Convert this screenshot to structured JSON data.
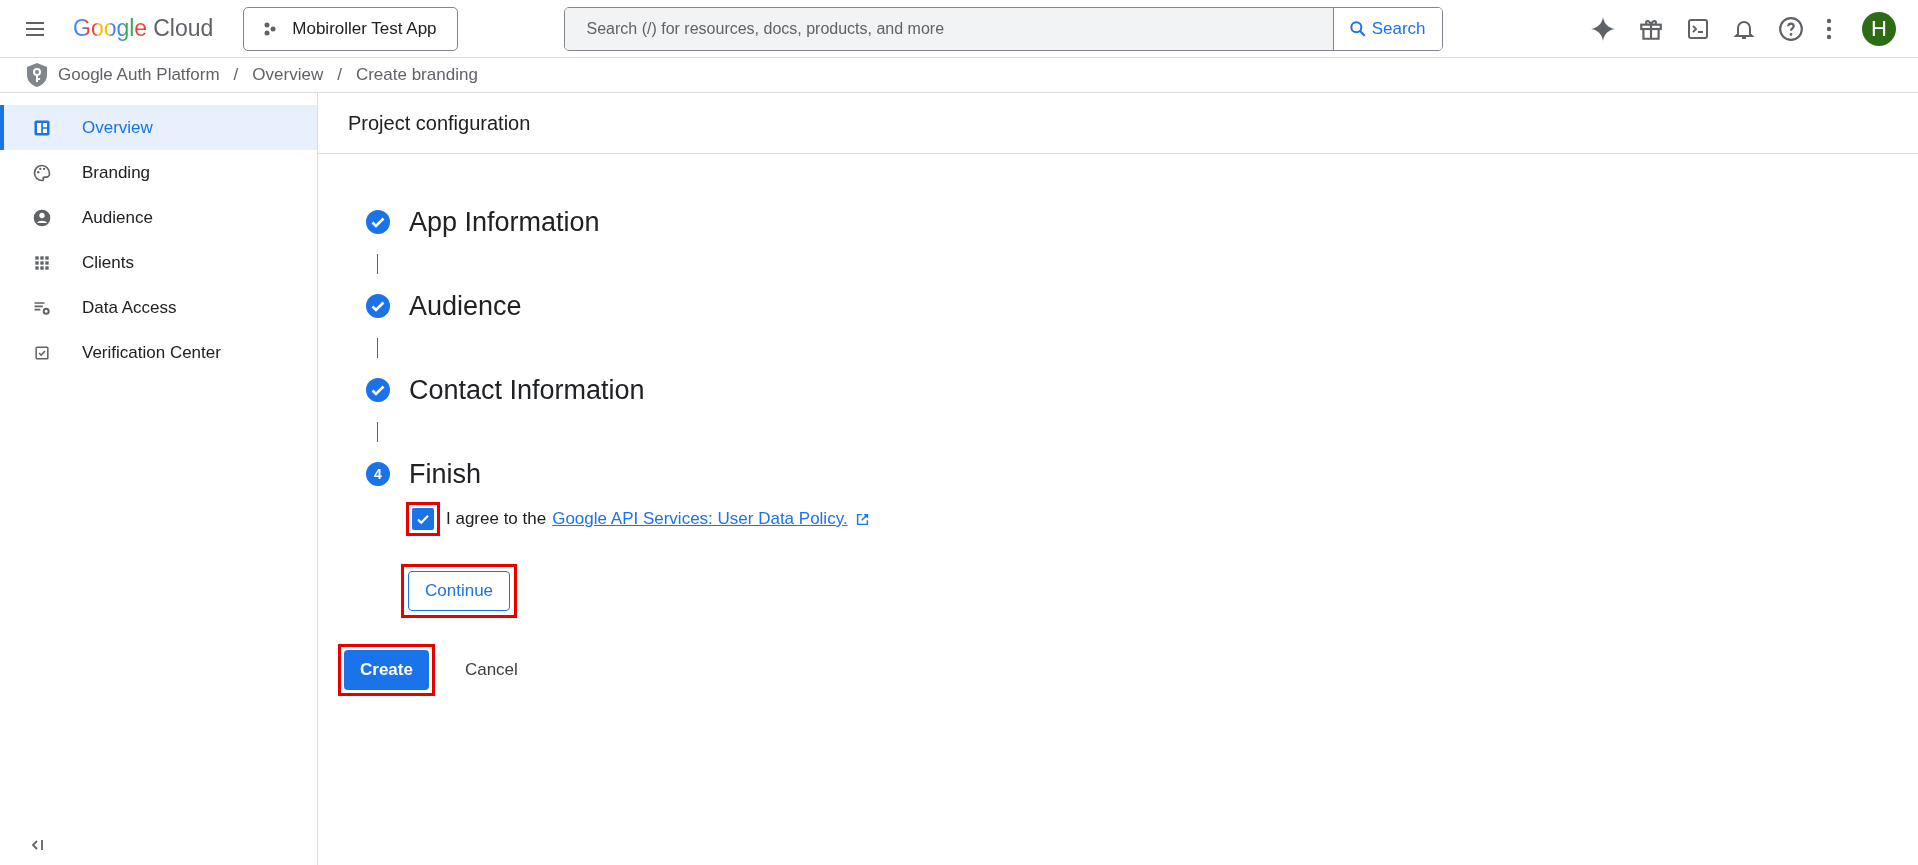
{
  "topbar": {
    "logo_brand": "Google",
    "logo_product": "Cloud",
    "project": "Mobiroller Test App",
    "search": {
      "placeholder": "Search (/) for resources, docs, products, and more",
      "button": "Search"
    },
    "avatar": "H"
  },
  "breadcrumb": {
    "separator": "/",
    "items": [
      "Google Auth Platform",
      "Overview",
      "Create branding"
    ]
  },
  "sidebar": {
    "items": [
      {
        "label": "Overview",
        "selected": true
      },
      {
        "label": "Branding",
        "selected": false
      },
      {
        "label": "Audience",
        "selected": false
      },
      {
        "label": "Clients",
        "selected": false
      },
      {
        "label": "Data Access",
        "selected": false
      },
      {
        "label": "Verification Center",
        "selected": false
      }
    ]
  },
  "content": {
    "title": "Project configuration",
    "steps": [
      {
        "label": "App Information",
        "completed": true
      },
      {
        "label": "Audience",
        "completed": true
      },
      {
        "label": "Contact Information",
        "completed": true
      },
      {
        "label": "Finish",
        "number": "4",
        "completed": false
      }
    ],
    "agreement": {
      "checked": true,
      "highlighted": true,
      "text": "I agree to the",
      "link": "Google API Services: User Data Policy."
    },
    "continue_button": {
      "label": "Continue",
      "highlighted": true
    },
    "create_button": {
      "label": "Create",
      "highlighted": true
    },
    "cancel_button": {
      "label": "Cancel"
    }
  }
}
